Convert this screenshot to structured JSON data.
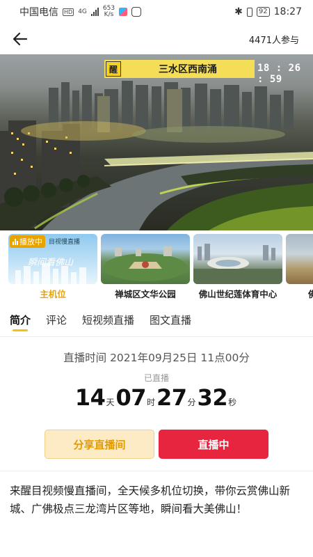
{
  "status_bar": {
    "carrier": "中国电信",
    "network_badge": "HD",
    "network_type": "4G",
    "speed_value": "653",
    "speed_unit": "K/s",
    "battery": "92",
    "time": "18:27"
  },
  "nav": {
    "participants": "4471人参与"
  },
  "video": {
    "overlay_logo": "醒",
    "location": "三水区西南涌",
    "timestamp": "18 : 26 : 59"
  },
  "thumbnails": [
    {
      "label": "主机位",
      "badge": "播放中",
      "active": true
    },
    {
      "label": "禅城区文华公园",
      "active": false
    },
    {
      "label": "佛山世纪莲体育中心",
      "active": false
    },
    {
      "label": "佛",
      "active": false
    }
  ],
  "thumb_caption": "瞬间看佛山",
  "thumb_header": "目视慢直播",
  "tabs": [
    {
      "label": "简介",
      "active": true
    },
    {
      "label": "评论",
      "active": false
    },
    {
      "label": "短视频直播",
      "active": false
    },
    {
      "label": "图文直播",
      "active": false
    }
  ],
  "info": {
    "start_time": "直播时间 2021年09月25日 11点00分",
    "aired_label": "已直播",
    "counter": {
      "days": "14",
      "days_unit": "天",
      "hours": "07",
      "hours_unit": "时",
      "minutes": "27",
      "minutes_unit": "分",
      "seconds": "32",
      "seconds_unit": "秒"
    }
  },
  "buttons": {
    "share": "分享直播间",
    "live": "直播中"
  },
  "intro": "来醒目视频慢直播间，全天候多机位切换，带你云赏佛山新城、广佛极点三龙湾片区等地，瞬间看大美佛山！",
  "colors": {
    "accent_yellow": "#f5c400",
    "accent_orange": "#e8a300",
    "live_red": "#e8253f",
    "share_bg": "#fdebc6"
  }
}
